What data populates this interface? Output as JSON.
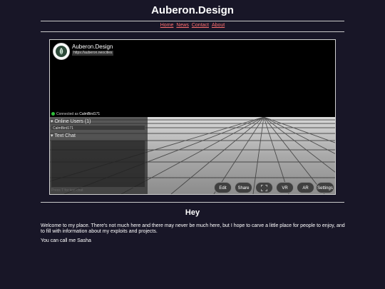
{
  "site": {
    "title": "Auberon.Design"
  },
  "nav": {
    "items": [
      "Home",
      "News",
      "Contact",
      "About"
    ]
  },
  "embed": {
    "room_name": "Auberon.Design",
    "room_url": "https://auberon.neocities",
    "status_prefix": "Connected as",
    "username": "CalmBird171",
    "online_users_header": "▾ Online Users (1)",
    "online_user": "CalmBird171",
    "text_chat_header": "▾ Text Chat",
    "chat_placeholder": "Press T for text chat",
    "buttons": {
      "edit": "Edit",
      "share": "Share",
      "vr": "VR",
      "ar": "AR",
      "settings": "Settings"
    },
    "status_color": "#2fbf3a"
  },
  "content": {
    "heading": "Hey",
    "paragraph1": "Welcome to my place. There's not much here and there may never be much here, but I hope to carve a little place for people to enjoy, and to fill with information about my exploits and projects.",
    "paragraph2": "You can call me Sasha"
  },
  "colors": {
    "background": "#181627",
    "link": "#ff6f6f"
  }
}
